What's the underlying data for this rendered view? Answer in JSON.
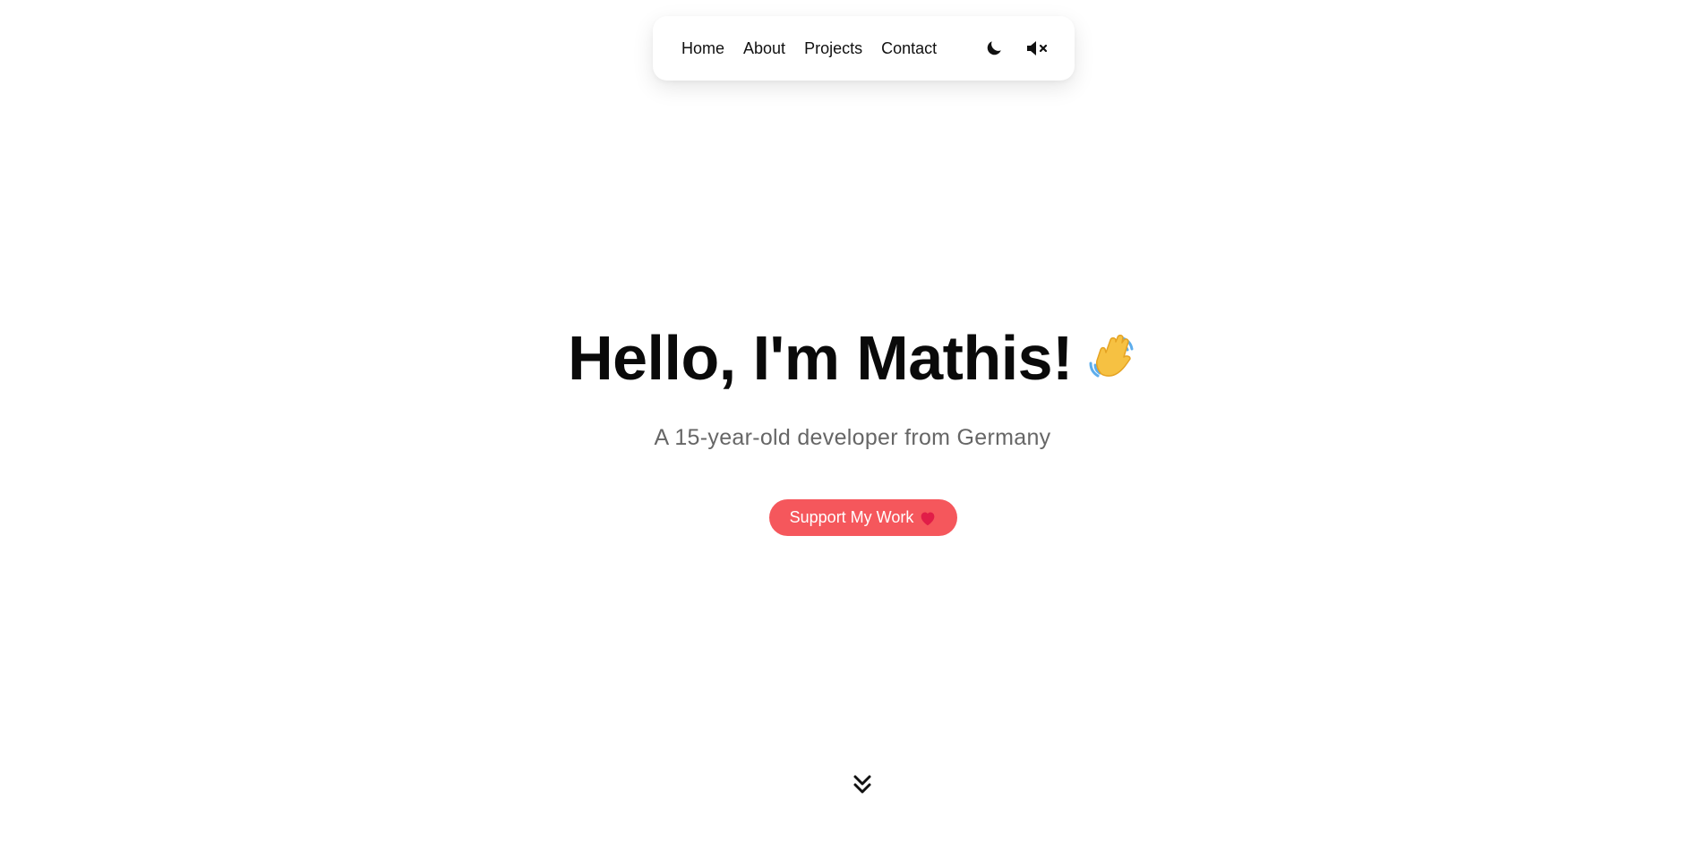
{
  "nav": {
    "links": [
      "Home",
      "About",
      "Projects",
      "Contact"
    ],
    "theme_icon": "moon-icon",
    "sound_icon": "volume-mute-icon"
  },
  "hero": {
    "title": "Hello, I'm Mathis!",
    "title_icon": "waving-hand-icon",
    "subtitle": "A 15-year-old developer from Germany",
    "button_label": "Support My Work",
    "button_icon": "heart-icon"
  },
  "scroll_icon": "chevrons-down-icon",
  "colors": {
    "accent": "#f5575c",
    "heart": "#e11d48",
    "text": "#0a0a0a",
    "muted": "#666666"
  }
}
